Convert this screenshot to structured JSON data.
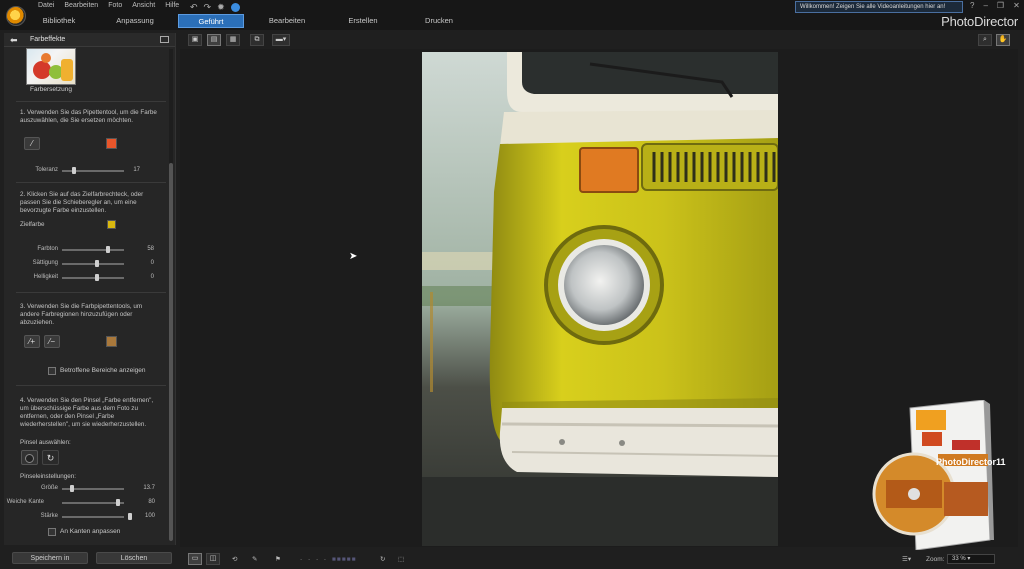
{
  "menu": [
    "Datei",
    "Bearbeiten",
    "Foto",
    "Ansicht",
    "Hilfe"
  ],
  "welcome_text": "Willkommen! Zeigen Sie alle Videoanleitungen hier an!",
  "brand": "PhotoDirector",
  "tabs": [
    {
      "label": "Bibliothek",
      "active": false
    },
    {
      "label": "Anpassung",
      "active": false
    },
    {
      "label": "Geführt",
      "active": true
    },
    {
      "label": "Bearbeiten",
      "active": false
    },
    {
      "label": "Erstellen",
      "active": false
    },
    {
      "label": "Drucken",
      "active": false
    }
  ],
  "panel": {
    "title": "Farbeffekte",
    "thumb_label": "Farbersetzung",
    "step1": "1. Verwenden Sie das Pipettentool, um die Farbe auszuwählen, die Sie ersetzen möchten.",
    "step1_color": "#e8552a",
    "tolerance": {
      "label": "Toleranz",
      "value": "17",
      "level": 0.17
    },
    "step2": "2. Klicken Sie auf das Zielfarbrechteck, oder passen Sie die Schieberegler an, um eine bevorzugte Farbe einzustellen.",
    "target_label": "Zielfarbe",
    "target_color": "#d9b80f",
    "sliders": [
      {
        "label": "Farbton",
        "value": "58",
        "level": 0.58
      },
      {
        "label": "Sättigung",
        "value": "0",
        "level": 0.5
      },
      {
        "label": "Helligkeit",
        "value": "0",
        "level": 0.5
      }
    ],
    "step3": "3. Verwenden Sie die Farbpipettentools, um andere Farbregionen hinzuzufügen oder abzuziehen.",
    "step3_color": "#a9783b",
    "show_affected": "Betroffene Bereiche anzeigen",
    "step4": "4. Verwenden Sie den Pinsel „Farbe entfernen\", um überschüssige Farbe aus dem Foto zu entfernen, oder den Pinsel „Farbe wiederherstellen\", um sie wiederherzustellen.",
    "brush_select": "Pinsel auswählen:",
    "brush_settings": "Pinseleinstellungen:",
    "brush_sliders": [
      {
        "label": "Größe",
        "value": "13.7",
        "level": 0.14
      },
      {
        "label": "Weiche Kante",
        "value": "80",
        "level": 0.8
      },
      {
        "label": "Stärke",
        "value": "100",
        "level": 1.0
      }
    ],
    "edges_label": "An Kanten anpassen",
    "save_label": "Speichern in",
    "delete_label": "Löschen"
  },
  "zoom": {
    "label": "Zoom:",
    "value": "33 %"
  },
  "product": {
    "title": "PhotoDirector11"
  }
}
